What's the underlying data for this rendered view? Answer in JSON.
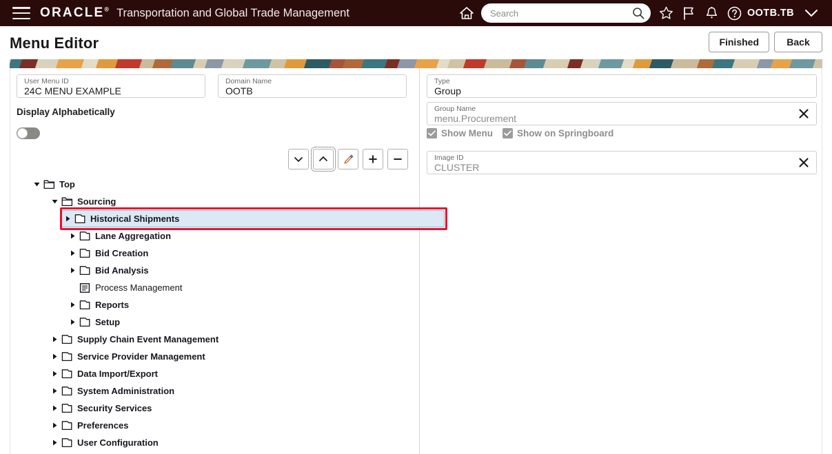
{
  "topbar": {
    "menu_icon": "hamburger-icon",
    "brand": "ORACLE",
    "app_title": "Transportation and Global Trade Management",
    "home_icon": "home-icon",
    "search": {
      "value": "",
      "placeholder": "Search",
      "icon": "search-icon"
    },
    "favorites_icon": "star-icon",
    "flag_icon": "flag-icon",
    "notifications_icon": "bell-icon",
    "help_icon": "help-icon",
    "user": "OOTB.TB",
    "user_chevron_icon": "chevron-down-icon",
    "bg_color": "#2a0b0a"
  },
  "page": {
    "title": "Menu Editor",
    "buttons": {
      "finished": "Finished",
      "back": "Back"
    }
  },
  "left_pane": {
    "user_menu_id": {
      "label": "User Menu ID",
      "value": "24C MENU EXAMPLE"
    },
    "domain_name": {
      "label": "Domain Name",
      "value": "OOTB"
    },
    "display_alphabetically": {
      "label": "Display Alphabetically",
      "state": "off"
    },
    "toolbar": [
      {
        "name": "move-down-button",
        "icon": "chevron-down-icon",
        "focused": false
      },
      {
        "name": "move-up-button",
        "icon": "chevron-up-icon",
        "focused": true
      },
      {
        "name": "edit-button",
        "icon": "pencil-icon",
        "focused": false
      },
      {
        "name": "add-button",
        "icon": "plus-icon",
        "focused": false
      },
      {
        "name": "remove-button",
        "icon": "minus-icon",
        "focused": false
      }
    ],
    "tree": [
      {
        "label": "Top",
        "level": 0,
        "type": "folder",
        "state": "expanded",
        "selected": false
      },
      {
        "label": "Sourcing",
        "level": 1,
        "type": "folder",
        "state": "expanded",
        "selected": false
      },
      {
        "label": "Historical Shipments",
        "level": 2,
        "type": "folder",
        "state": "collapsed",
        "selected": true
      },
      {
        "label": "Lane Aggregation",
        "level": 2,
        "type": "folder",
        "state": "collapsed",
        "selected": false
      },
      {
        "label": "Bid Creation",
        "level": 2,
        "type": "folder",
        "state": "collapsed",
        "selected": false
      },
      {
        "label": "Bid Analysis",
        "level": 2,
        "type": "folder",
        "state": "collapsed",
        "selected": false
      },
      {
        "label": "Process Management",
        "level": 2,
        "type": "leaf",
        "state": "none",
        "selected": false
      },
      {
        "label": "Reports",
        "level": 2,
        "type": "folder",
        "state": "collapsed",
        "selected": false
      },
      {
        "label": "Setup",
        "level": 2,
        "type": "folder",
        "state": "collapsed",
        "selected": false
      },
      {
        "label": "Supply Chain Event Management",
        "level": 1,
        "type": "folder",
        "state": "collapsed",
        "selected": false
      },
      {
        "label": "Service Provider Management",
        "level": 1,
        "type": "folder",
        "state": "collapsed",
        "selected": false
      },
      {
        "label": "Data Import/Export",
        "level": 1,
        "type": "folder",
        "state": "collapsed",
        "selected": false
      },
      {
        "label": "System Administration",
        "level": 1,
        "type": "folder",
        "state": "collapsed",
        "selected": false
      },
      {
        "label": "Security Services",
        "level": 1,
        "type": "folder",
        "state": "collapsed",
        "selected": false
      },
      {
        "label": "Preferences",
        "level": 1,
        "type": "folder",
        "state": "collapsed",
        "selected": false
      },
      {
        "label": "User Configuration",
        "level": 1,
        "type": "folder",
        "state": "collapsed",
        "selected": false
      }
    ],
    "selection_highlight_color": "#e8112d"
  },
  "right_pane": {
    "type": {
      "label": "Type",
      "value": "Group"
    },
    "group_name": {
      "label": "Group Name",
      "value": "menu.Procurement",
      "clear_icon": "close-icon"
    },
    "checkboxes": [
      {
        "label": "Show Menu",
        "checked": true
      },
      {
        "label": "Show on Springboard",
        "checked": true
      }
    ],
    "image_id": {
      "label": "Image ID",
      "value": "CLUSTER",
      "clear_icon": "close-icon"
    }
  }
}
